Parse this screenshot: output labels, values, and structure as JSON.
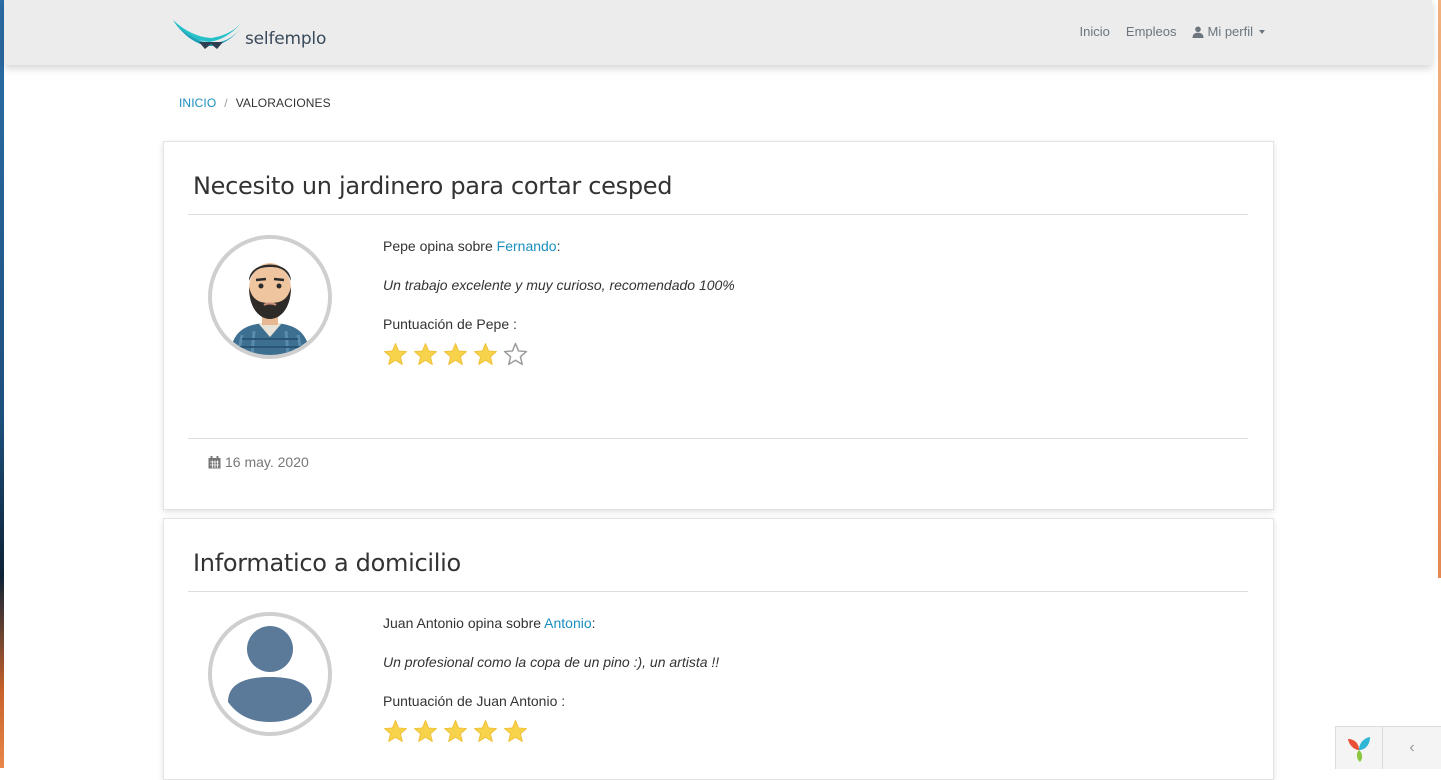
{
  "brand": {
    "name": "selfemplo"
  },
  "nav": {
    "home": "Inicio",
    "jobs": "Empleos",
    "profile": "Mi perfil"
  },
  "breadcrumb": {
    "home": "INICIO",
    "separator": "/",
    "current": "VALORACIONES"
  },
  "reviews": [
    {
      "title": "Necesito un jardinero para cortar cesped",
      "reviewer": "Pepe",
      "opina_text": " opina sobre ",
      "target": "Fernando",
      "colon": ":",
      "comment": "Un trabajo excelente y muy curioso, recomendado 100%",
      "score_label": "Puntuación de Pepe :",
      "rating": 4,
      "max_rating": 5,
      "date": "16 may. 2020",
      "avatar": "bearded-man-avatar"
    },
    {
      "title": "Informatico a domicilio",
      "reviewer": "Juan Antonio",
      "opina_text": " opina sobre ",
      "target": "Antonio",
      "colon": ":",
      "comment": "Un profesional como la copa de un pino :), un artista !!",
      "score_label": "Puntuación de Juan Antonio :",
      "rating": 5,
      "max_rating": 5,
      "avatar": "default-user-avatar"
    }
  ],
  "colors": {
    "link": "#1a8fbf",
    "star": "#f7d24b",
    "star_empty": "#9a9a9a",
    "navbar": "#ececec"
  },
  "debug_toolbar": {
    "toggle_glyph": "‹"
  }
}
